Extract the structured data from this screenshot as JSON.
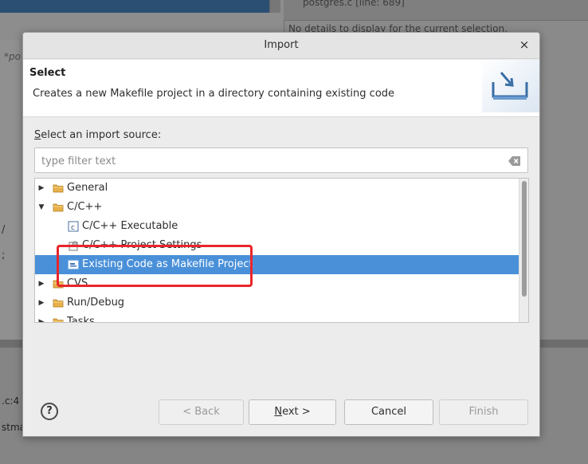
{
  "background": {
    "right_tree_item": "postgres.c [line: 689]",
    "details_text": "No details to display for the current selection.",
    "editor_tab": "*po",
    "code_line1": "/",
    "code_line2": ";",
    "bottom_line1": ".c:4",
    "bottom_line2": "stma"
  },
  "dialog": {
    "title": "Import",
    "close_glyph": "×"
  },
  "header": {
    "title": "Select",
    "description": "Creates a new Makefile project in a directory containing existing code",
    "icon": "import-wizard-icon"
  },
  "source": {
    "label_mnemonic": "S",
    "label_rest": "elect an import source:"
  },
  "filter": {
    "placeholder": "type filter text",
    "value": "",
    "clear_icon": "clear-filter-icon"
  },
  "tree": {
    "items": [
      {
        "label": "General",
        "expanded": false,
        "icon": "folder-icon"
      },
      {
        "label": "C/C++",
        "expanded": true,
        "icon": "folder-icon"
      },
      {
        "label": "C/C++ Executable",
        "icon": "c-executable-icon"
      },
      {
        "label": "C/C++ Project Settings",
        "icon": "settings-icon"
      },
      {
        "label": "Existing Code as Makefile Project",
        "icon": "makefile-project-icon",
        "selected": true
      },
      {
        "label": "CVS",
        "expanded": false,
        "icon": "folder-icon"
      },
      {
        "label": "Run/Debug",
        "expanded": false,
        "icon": "folder-icon"
      },
      {
        "label": "Tasks",
        "expanded": false,
        "icon": "folder-icon"
      }
    ]
  },
  "annotation": {
    "color": "#e8262b"
  },
  "colors": {
    "selection": "#4a90d9",
    "folder": "#e8b04a"
  },
  "buttons": {
    "help": "?",
    "back": "< Back",
    "next_mnemonic": "N",
    "next_rest": "ext >",
    "cancel": "Cancel",
    "finish": "Finish"
  }
}
